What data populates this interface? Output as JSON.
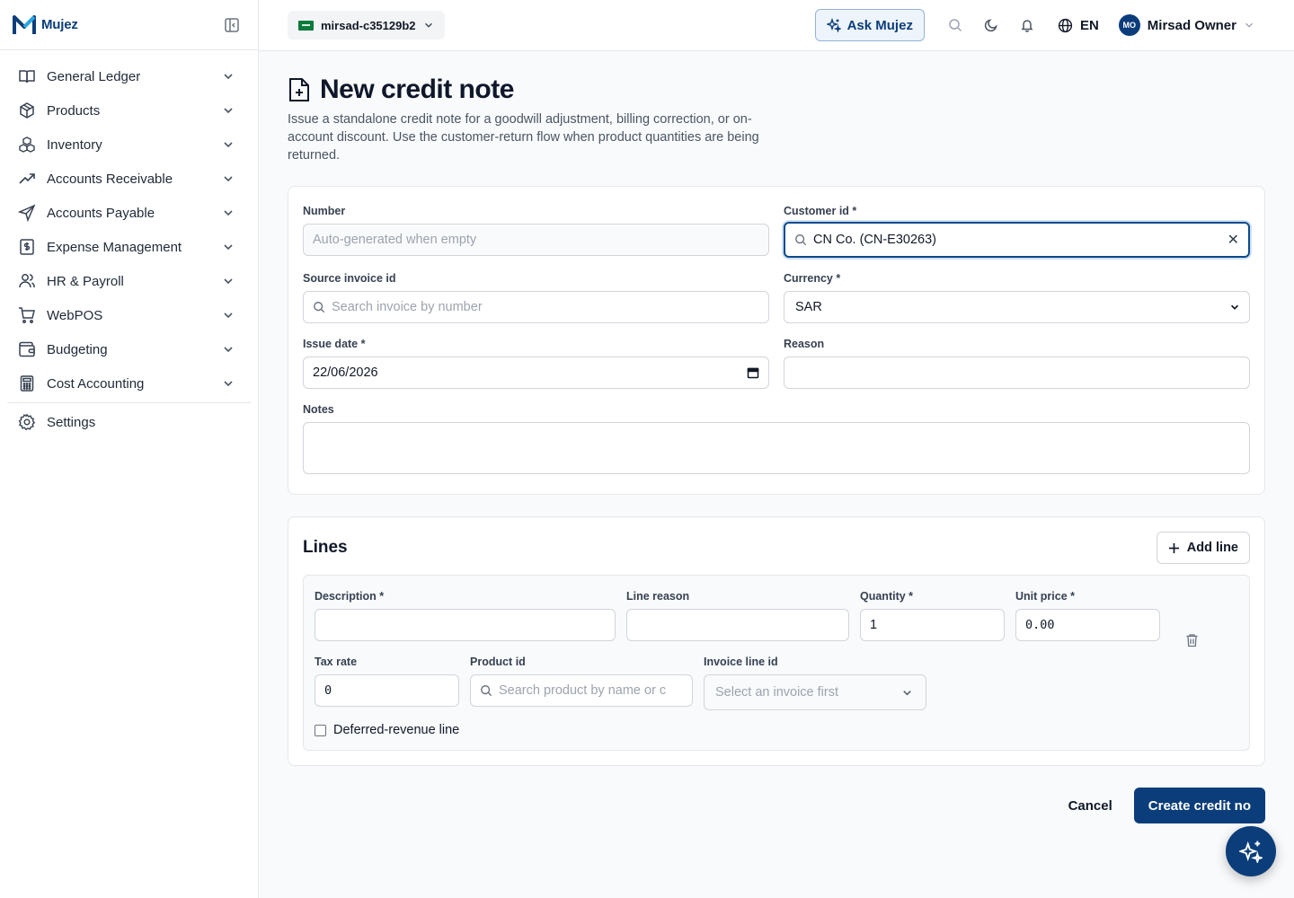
{
  "brand": {
    "name": "Mujez"
  },
  "sidebar": {
    "items": [
      {
        "label": "General Ledger",
        "icon": "book-icon"
      },
      {
        "label": "Products",
        "icon": "box-icon"
      },
      {
        "label": "Inventory",
        "icon": "boxes-icon"
      },
      {
        "label": "Accounts Receivable",
        "icon": "trending-up-icon"
      },
      {
        "label": "Accounts Payable",
        "icon": "send-icon"
      },
      {
        "label": "Expense Management",
        "icon": "receipt-icon"
      },
      {
        "label": "HR & Payroll",
        "icon": "users-icon"
      },
      {
        "label": "WebPOS",
        "icon": "cart-icon"
      },
      {
        "label": "Budgeting",
        "icon": "wallet-icon"
      },
      {
        "label": "Cost Accounting",
        "icon": "calculator-icon"
      }
    ],
    "settings_label": "Settings"
  },
  "topbar": {
    "org": "mirsad-c35129b2",
    "ask_label": "Ask Mujez",
    "lang": "EN",
    "user_initials": "MO",
    "user_name": "Mirsad Owner"
  },
  "page": {
    "title": "New credit note",
    "description": "Issue a standalone credit note for a goodwill adjustment, billing correction, or on-account discount. Use the customer-return flow when product quantities are being returned."
  },
  "form": {
    "number_label": "Number",
    "number_placeholder": "Auto-generated when empty",
    "customer_label": "Customer id *",
    "customer_value": "CN Co. (CN-E30263)",
    "source_invoice_label": "Source invoice id",
    "source_invoice_placeholder": "Search invoice by number",
    "currency_label": "Currency *",
    "currency_value": "SAR",
    "issue_date_label": "Issue date *",
    "issue_date_value": "22/06/2026",
    "reason_label": "Reason",
    "notes_label": "Notes"
  },
  "lines": {
    "title": "Lines",
    "add_label": "Add line",
    "description_label": "Description *",
    "line_reason_label": "Line reason",
    "quantity_label": "Quantity *",
    "quantity_value": "1",
    "unit_price_label": "Unit price *",
    "unit_price_value": "0.00",
    "tax_rate_label": "Tax rate",
    "tax_rate_value": "0",
    "product_label": "Product id",
    "product_placeholder": "Search product by name or c",
    "invoice_line_label": "Invoice line id",
    "invoice_line_placeholder": "Select an invoice first",
    "deferred_label": "Deferred-revenue line"
  },
  "actions": {
    "cancel": "Cancel",
    "create": "Create credit no"
  },
  "colors": {
    "brand": "#0b3d7a",
    "focus_border": "#0b4a8b"
  }
}
